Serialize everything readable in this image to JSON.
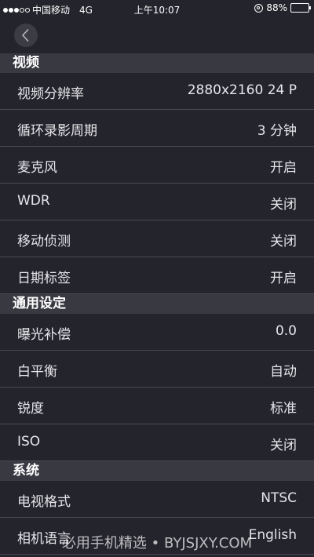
{
  "status_bar": {
    "carrier": "中国移动",
    "network": "4G",
    "time": "上午10:07",
    "battery_text": "88%",
    "battery_level": 0.88,
    "battery_color": "#4cd964"
  },
  "nav": {
    "back_icon": "chevron-left-icon"
  },
  "sections": [
    {
      "title": "视频",
      "rows": [
        {
          "label": "视频分辨率",
          "value": "2880x2160 24 P"
        },
        {
          "label": "循环录影周期",
          "value": "3 分钟"
        },
        {
          "label": "麦克风",
          "value": "开启"
        },
        {
          "label": "WDR",
          "value": "关闭"
        },
        {
          "label": "移动侦测",
          "value": "关闭"
        },
        {
          "label": "日期标签",
          "value": "开启"
        }
      ]
    },
    {
      "title": "通用设定",
      "rows": [
        {
          "label": "曝光补偿",
          "value": "0.0"
        },
        {
          "label": "白平衡",
          "value": "自动"
        },
        {
          "label": "锐度",
          "value": "标准"
        },
        {
          "label": "ISO",
          "value": "关闭"
        }
      ]
    },
    {
      "title": "系统",
      "rows": [
        {
          "label": "电视格式",
          "value": "NTSC"
        },
        {
          "label": "相机语言",
          "value": "English"
        }
      ]
    }
  ],
  "watermark": "必用手机精选 • BYJSJXY.COM"
}
